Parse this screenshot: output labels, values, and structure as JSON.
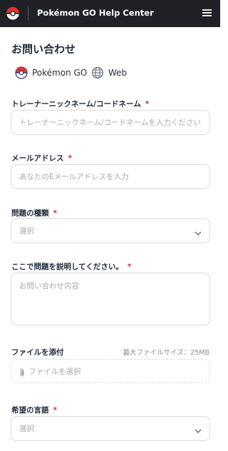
{
  "header": {
    "title": "Pokémon GO Help Center",
    "logo_icon": "pokeball-icon",
    "menu_icon": "hamburger-menu-icon"
  },
  "page": {
    "title": "お問い合わせ"
  },
  "platforms": [
    {
      "label": "Pokémon GO",
      "icon": "pokeball-icon"
    },
    {
      "label": "Web",
      "icon": "globe-icon"
    }
  ],
  "form": {
    "trainer_name": {
      "label": "トレーナーニックネーム/コードネーム",
      "required_mark": "*",
      "placeholder": "トレーナーニックネーム/コードネームを入力ください"
    },
    "email": {
      "label": "メールアドレス",
      "required_mark": "*",
      "placeholder": "あなたのEメールアドレスを入力"
    },
    "issue_type": {
      "label": "問題の種類",
      "required_mark": "*",
      "value": "選択"
    },
    "description": {
      "label": "ここで問題を説明してください。",
      "required_mark": "*",
      "placeholder": "お問い合わせ内容"
    },
    "attachment": {
      "label": "ファイルを添付",
      "max_size": "最大ファイルサイズ：25MB",
      "button": "ファイルを選択"
    },
    "language": {
      "label": "希望の言語",
      "required_mark": "*",
      "value": "選択"
    }
  },
  "colors": {
    "header_bg": "#1f2126",
    "required": "#d6293a",
    "border": "#d7dbe0",
    "placeholder": "#a4a9b0"
  }
}
